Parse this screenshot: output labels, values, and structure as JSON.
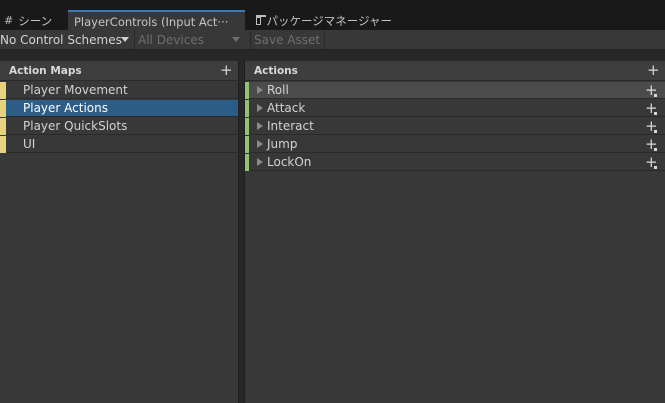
{
  "tabs": [
    {
      "label": "シーン",
      "icon": "grid-icon"
    },
    {
      "label": "PlayerControls (Input Act···",
      "icon": ""
    },
    {
      "label": "パッケージマネージャー",
      "icon": "package-icon"
    }
  ],
  "toolbar": {
    "control_schemes": "No Control Schemes",
    "devices": "All Devices",
    "save": "Save Asset"
  },
  "action_maps": {
    "title": "Action Maps",
    "items": [
      {
        "label": "Player Movement"
      },
      {
        "label": "Player Actions"
      },
      {
        "label": "Player QuickSlots"
      },
      {
        "label": "UI"
      }
    ],
    "selected_index": 1
  },
  "actions": {
    "title": "Actions",
    "items": [
      {
        "label": "Roll"
      },
      {
        "label": "Attack"
      },
      {
        "label": "Interact"
      },
      {
        "label": "Jump"
      },
      {
        "label": "LockOn"
      }
    ]
  },
  "colors": {
    "map_stripe": "#e7d27e",
    "action_stripe": "#93c373",
    "selection": "#2c5d87",
    "active_tab_accent": "#3a79bb"
  }
}
